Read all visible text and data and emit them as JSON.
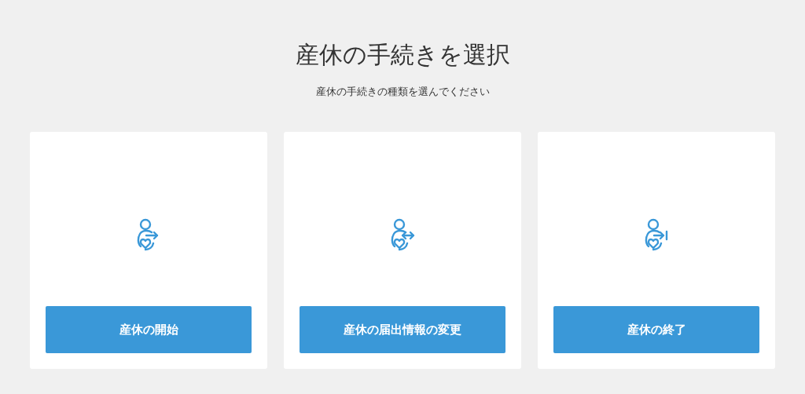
{
  "title": "産休の手続きを選択",
  "subtitle": "産休の手続きの種類を選んでください",
  "cards": [
    {
      "kind": "start",
      "button": "産休の開始"
    },
    {
      "kind": "change",
      "button": "産休の届出情報の変更"
    },
    {
      "kind": "end",
      "button": "産休の終了"
    }
  ]
}
